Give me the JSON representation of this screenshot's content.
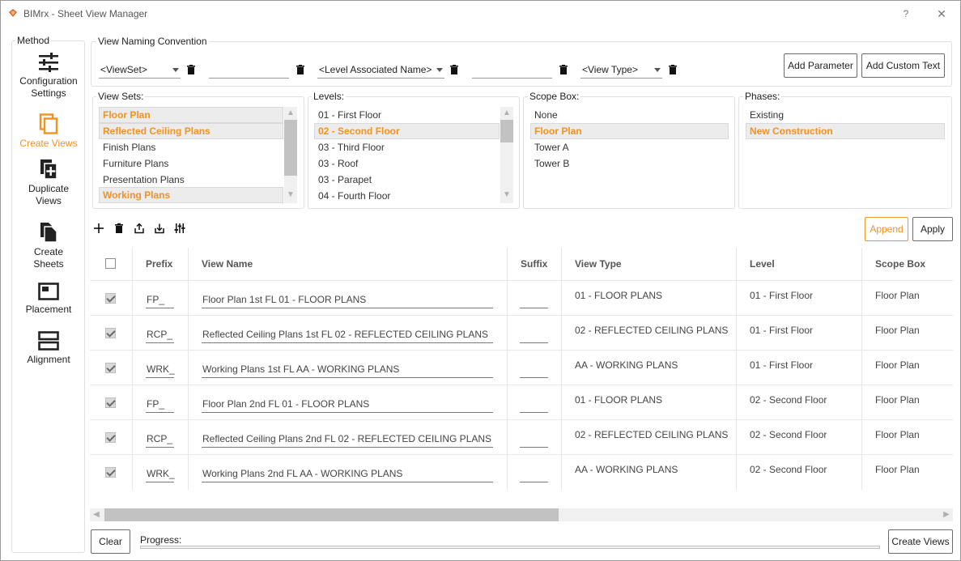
{
  "window": {
    "title": "BIMrx - Sheet View Manager",
    "help": "?",
    "close": "✕"
  },
  "sidebar": {
    "legend": "Method",
    "items": [
      {
        "label": "Configuration\nSettings",
        "icon": "sliders-icon",
        "active": false
      },
      {
        "label": "Create Views",
        "icon": "copy-views-icon",
        "active": true
      },
      {
        "label": "Duplicate\nViews",
        "icon": "duplicate-icon",
        "active": false
      },
      {
        "label": "Create\nSheets",
        "icon": "sheets-icon",
        "active": false
      },
      {
        "label": "Placement",
        "icon": "placement-icon",
        "active": false
      },
      {
        "label": "Alignment",
        "icon": "alignment-icon",
        "active": false
      }
    ]
  },
  "naming": {
    "legend": "View Naming Convention",
    "combo1": "<ViewSet>",
    "field1": "",
    "combo2": "<Level Associated Name>",
    "field2": "",
    "combo3": "<View Type>",
    "add_parameter": "Add Parameter",
    "add_custom_text": "Add Custom Text"
  },
  "view_sets": {
    "legend": "View Sets:",
    "items": [
      {
        "label": "Floor Plan",
        "selected": true
      },
      {
        "label": "Reflected Ceiling Plans",
        "selected": true
      },
      {
        "label": "Finish Plans",
        "selected": false
      },
      {
        "label": "Furniture Plans",
        "selected": false
      },
      {
        "label": "Presentation Plans",
        "selected": false
      },
      {
        "label": "Working Plans",
        "selected": true
      }
    ]
  },
  "levels": {
    "legend": "Levels:",
    "items": [
      {
        "label": "01 - First Floor",
        "selected": false
      },
      {
        "label": "02 - Second Floor",
        "selected": true
      },
      {
        "label": "03 - Third Floor",
        "selected": false
      },
      {
        "label": "03 - Roof",
        "selected": false
      },
      {
        "label": "03 - Parapet",
        "selected": false
      },
      {
        "label": "04 - Fourth Floor",
        "selected": false
      }
    ]
  },
  "scope_box": {
    "legend": "Scope Box:",
    "items": [
      {
        "label": "None",
        "selected": false
      },
      {
        "label": "Floor Plan",
        "selected": true
      },
      {
        "label": "Tower A",
        "selected": false
      },
      {
        "label": "Tower B",
        "selected": false
      }
    ]
  },
  "phases": {
    "legend": "Phases:",
    "items": [
      {
        "label": "Existing",
        "selected": false
      },
      {
        "label": "New Construction",
        "selected": true
      }
    ]
  },
  "actions": {
    "append": "Append",
    "apply": "Apply"
  },
  "grid": {
    "headers": {
      "prefix": "Prefix",
      "view_name": "View Name",
      "suffix": "Suffix",
      "view_type": "View Type",
      "level": "Level",
      "scope_box": "Scope Box"
    },
    "rows": [
      {
        "checked": true,
        "prefix": "FP_",
        "view_name": "Floor Plan 1st FL 01 - FLOOR PLANS",
        "suffix": "",
        "view_type": "01 - FLOOR PLANS",
        "level": "01 - First Floor",
        "scope_box": "Floor Plan"
      },
      {
        "checked": true,
        "prefix": "RCP_",
        "view_name": "Reflected Ceiling Plans 1st FL 02 - REFLECTED CEILING PLANS",
        "suffix": "",
        "view_type": "02 - REFLECTED CEILING PLANS",
        "level": "01 - First Floor",
        "scope_box": "Floor Plan"
      },
      {
        "checked": true,
        "prefix": "WRK_",
        "view_name": "Working Plans 1st FL AA - WORKING PLANS",
        "suffix": "",
        "view_type": "AA - WORKING PLANS",
        "level": "01 - First Floor",
        "scope_box": "Floor Plan"
      },
      {
        "checked": true,
        "prefix": "FP_",
        "view_name": "Floor Plan 2nd FL 01 - FLOOR PLANS",
        "suffix": "",
        "view_type": "01 - FLOOR PLANS",
        "level": "02 - Second Floor",
        "scope_box": "Floor Plan"
      },
      {
        "checked": true,
        "prefix": "RCP_",
        "view_name": "Reflected Ceiling Plans 2nd FL 02 - REFLECTED CEILING PLANS",
        "suffix": "",
        "view_type": "02 - REFLECTED CEILING PLANS",
        "level": "02 - Second Floor",
        "scope_box": "Floor Plan"
      },
      {
        "checked": true,
        "prefix": "WRK_",
        "view_name": "Working Plans 2nd FL AA - WORKING PLANS",
        "suffix": "",
        "view_type": "AA - WORKING PLANS",
        "level": "02 - Second Floor",
        "scope_box": "Floor Plan"
      }
    ]
  },
  "footer": {
    "clear": "Clear",
    "progress_label": "Progress:",
    "progress": 0,
    "create_views": "Create Views"
  },
  "colors": {
    "accent": "#f29222",
    "selection_bg": "#ececec"
  }
}
